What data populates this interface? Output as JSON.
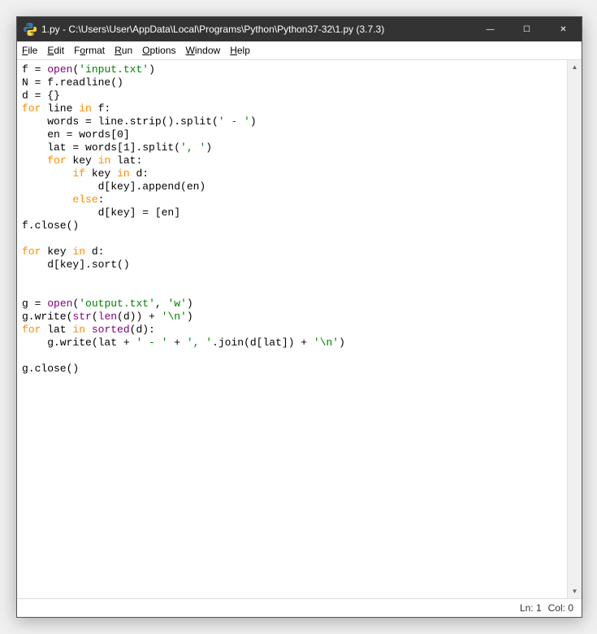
{
  "window": {
    "title": "1.py - C:\\Users\\User\\AppData\\Local\\Programs\\Python\\Python37-32\\1.py (3.7.3)"
  },
  "menu": {
    "file": "File",
    "edit": "Edit",
    "format": "Format",
    "run": "Run",
    "options": "Options",
    "window": "Window",
    "help": "Help"
  },
  "code": {
    "tokens": [
      [
        [
          "",
          "f = "
        ],
        [
          "builtin",
          "open"
        ],
        [
          "",
          "("
        ],
        [
          "str",
          "'input.txt'"
        ],
        [
          "",
          ")"
        ]
      ],
      [
        [
          "",
          "N = f.readline()"
        ]
      ],
      [
        [
          "",
          "d = {}"
        ]
      ],
      [
        [
          "kw",
          "for"
        ],
        [
          "",
          " line "
        ],
        [
          "kw",
          "in"
        ],
        [
          "",
          " f:"
        ]
      ],
      [
        [
          "",
          "    words = line.strip().split("
        ],
        [
          "str",
          "' - '"
        ],
        [
          "",
          ")"
        ]
      ],
      [
        [
          "",
          "    en = words[0]"
        ]
      ],
      [
        [
          "",
          "    lat = words[1].split("
        ],
        [
          "str",
          "', '"
        ],
        [
          "",
          ")"
        ]
      ],
      [
        [
          "",
          "    "
        ],
        [
          "kw",
          "for"
        ],
        [
          "",
          " key "
        ],
        [
          "kw",
          "in"
        ],
        [
          "",
          " lat:"
        ]
      ],
      [
        [
          "",
          "        "
        ],
        [
          "kw",
          "if"
        ],
        [
          "",
          " key "
        ],
        [
          "kw",
          "in"
        ],
        [
          "",
          " d:"
        ]
      ],
      [
        [
          "",
          "            d[key].append(en)"
        ]
      ],
      [
        [
          "",
          "        "
        ],
        [
          "kw",
          "else"
        ],
        [
          "",
          ":"
        ]
      ],
      [
        [
          "",
          "            d[key] = [en]"
        ]
      ],
      [
        [
          "",
          "f.close()"
        ]
      ],
      [
        [
          "",
          ""
        ]
      ],
      [
        [
          "kw",
          "for"
        ],
        [
          "",
          " key "
        ],
        [
          "kw",
          "in"
        ],
        [
          "",
          " d:"
        ]
      ],
      [
        [
          "",
          "    d[key].sort()"
        ]
      ],
      [
        [
          "",
          ""
        ]
      ],
      [
        [
          "",
          ""
        ]
      ],
      [
        [
          "",
          "g = "
        ],
        [
          "builtin",
          "open"
        ],
        [
          "",
          "("
        ],
        [
          "str",
          "'output.txt'"
        ],
        [
          "",
          ", "
        ],
        [
          "str",
          "'w'"
        ],
        [
          "",
          ")"
        ]
      ],
      [
        [
          "",
          "g.write("
        ],
        [
          "builtin",
          "str"
        ],
        [
          "",
          "("
        ],
        [
          "builtin",
          "len"
        ],
        [
          "",
          "(d)) + "
        ],
        [
          "str",
          "'\\n'"
        ],
        [
          "",
          ")"
        ]
      ],
      [
        [
          "kw",
          "for"
        ],
        [
          "",
          " lat "
        ],
        [
          "kw",
          "in"
        ],
        [
          "",
          " "
        ],
        [
          "builtin",
          "sorted"
        ],
        [
          "",
          "(d):"
        ]
      ],
      [
        [
          "",
          "    g.write(lat + "
        ],
        [
          "str",
          "' - '"
        ],
        [
          "",
          " + "
        ],
        [
          "str",
          "', '"
        ],
        [
          "",
          ".join(d[lat]) + "
        ],
        [
          "str",
          "'\\n'"
        ],
        [
          "",
          ")"
        ]
      ],
      [
        [
          "",
          ""
        ]
      ],
      [
        [
          "",
          "g.close()"
        ]
      ]
    ]
  },
  "status": {
    "ln": "Ln: 1",
    "col": "Col: 0"
  },
  "icons": {
    "minimize": "—",
    "maximize": "☐",
    "close": "✕",
    "scroll_up": "▲",
    "scroll_down": "▼"
  }
}
